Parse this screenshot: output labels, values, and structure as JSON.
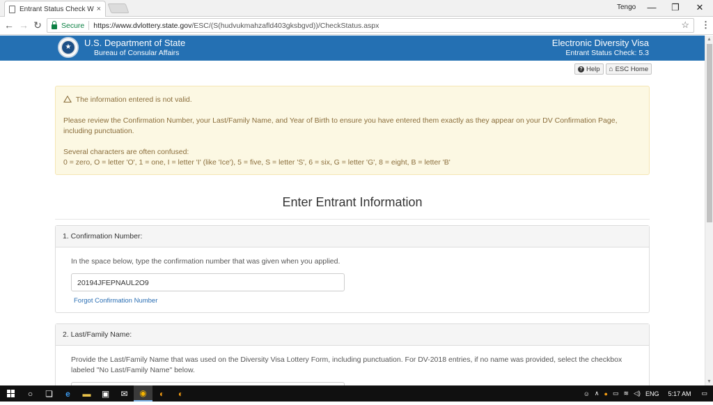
{
  "browser": {
    "tab_title": "Entrant Status Check Wel",
    "tab_close": "×",
    "user": "Tengo",
    "secure_label": "Secure",
    "url_domain": "https://www.dvlottery.state.gov",
    "url_path": "/ESC/(S(hudvukmahzafld403gksbgvd))/CheckStatus.aspx",
    "window_minimize": "—",
    "window_restore": "❐",
    "window_close": "✕",
    "back": "←",
    "forward": "→",
    "reload": "↻",
    "star": "☆",
    "menu": "⋮"
  },
  "header": {
    "dept": "U.S. Department of State",
    "bureau": "Bureau of Consular Affairs",
    "program": "Electronic Diversity Visa",
    "version": "Entrant Status Check: 5.3",
    "seal_glyph": "★"
  },
  "toolbar": {
    "help_icon": "?",
    "help_label": "Help",
    "home_icon": "⌂",
    "home_label": "ESC Home"
  },
  "alert": {
    "heading": "The information entered is not valid.",
    "message": "Please review the Confirmation Number, your Last/Family Name, and Year of Birth to ensure you have entered them exactly as they appear on your DV Confirmation Page, including punctuation.",
    "confused_title": "Several characters are often confused:",
    "confused_list": "0 = zero, O = letter 'O', 1 = one, I = letter 'I' (like 'Ice'), 5 = five, S = letter 'S', 6 = six, G = letter 'G', 8 = eight, B = letter 'B'"
  },
  "form": {
    "title": "Enter Entrant Information",
    "section1": {
      "label": "1. Confirmation Number:",
      "instructions": "In the space below, type the confirmation number that was given when you applied.",
      "value": "20194JFEPNAUL2O9",
      "forgot_link": "Forgot Confirmation Number"
    },
    "section2": {
      "label": "2. Last/Family Name:",
      "instructions": "Provide the Last/Family Name that was used on the Diversity Visa Lottery Form, including punctuation. For DV-2018 entries, if no name was provided, select the checkbox labeled \"No Last/Family Name\" below."
    }
  },
  "taskbar": {
    "search_icon": "○",
    "taskview_icon": "❏",
    "edge_icon": "e",
    "explorer_icon": "▬",
    "store_icon": "▣",
    "mail_icon": "✉",
    "chrome_icon": "◉",
    "app1_icon": "◐",
    "app2_icon": "◐",
    "people_icon": "☺",
    "chevron": "∧",
    "language": "ENG",
    "time": "5:17 AM",
    "notification_icon": "▭"
  }
}
